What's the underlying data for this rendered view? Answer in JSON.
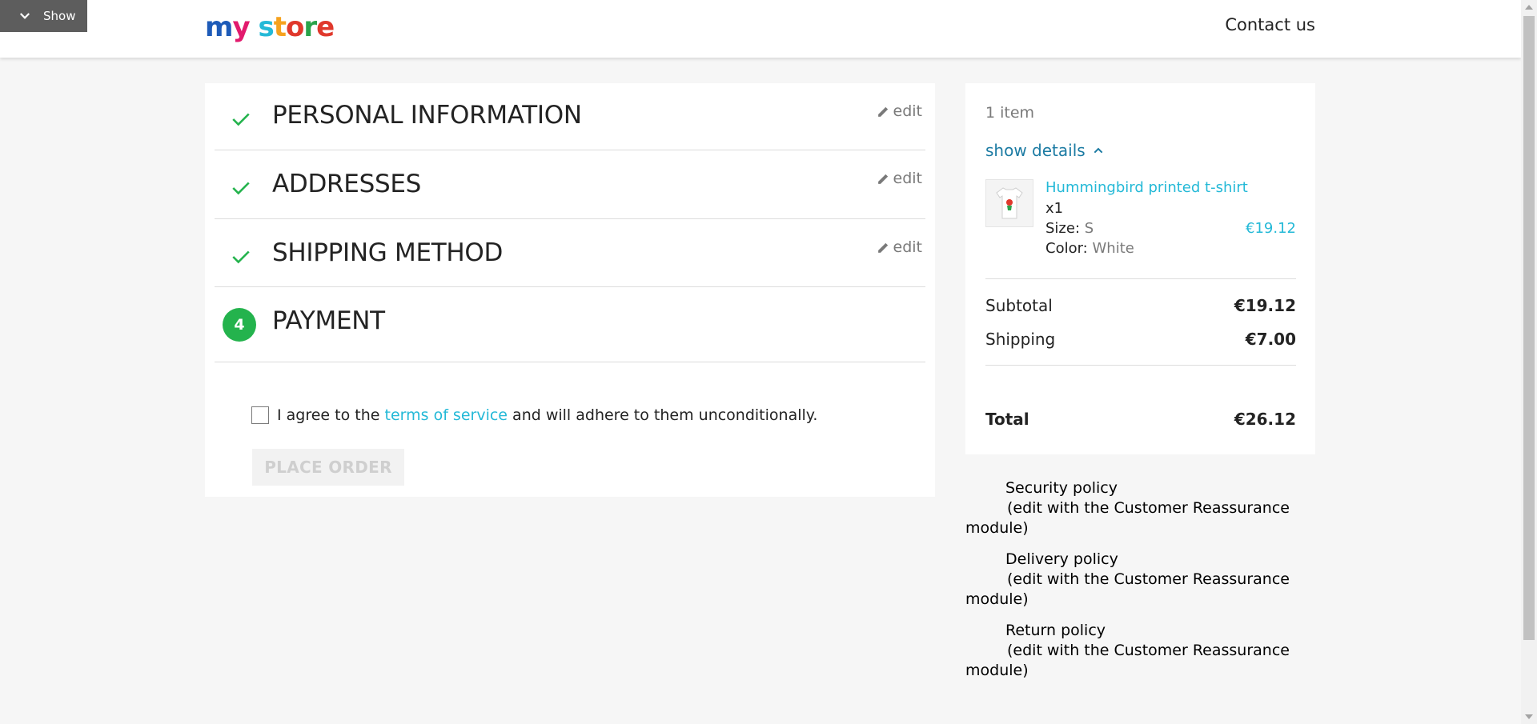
{
  "debug_toggle": {
    "label": "Show"
  },
  "header": {
    "logo_text": "my store",
    "contact_label": "Contact us"
  },
  "steps": [
    {
      "title": "PERSONAL INFORMATION",
      "status": "complete",
      "edit_label": "edit"
    },
    {
      "title": "ADDRESSES",
      "status": "complete",
      "edit_label": "edit"
    },
    {
      "title": "SHIPPING METHOD",
      "status": "complete",
      "edit_label": "edit"
    },
    {
      "title": "PAYMENT",
      "status": "current",
      "number": "4"
    }
  ],
  "terms": {
    "prefix": "I agree to the",
    "link": "terms of service",
    "suffix": "and will adhere to them unconditionally."
  },
  "place_order_label": "PLACE ORDER",
  "summary": {
    "items_count": "1 item",
    "show_details_label": "show details",
    "product": {
      "name": "Hummingbird printed t-shirt",
      "qty": "x1",
      "size_label": "Size:",
      "size_value": "S",
      "color_label": "Color:",
      "color_value": "White",
      "price": "€19.12"
    },
    "subtotal_label": "Subtotal",
    "subtotal_value": "€19.12",
    "shipping_label": "Shipping",
    "shipping_value": "€7.00",
    "total_label": "Total",
    "total_value": "€26.12"
  },
  "reassurance": [
    {
      "title": "Security policy",
      "desc": "(edit with the Customer Reassurance module)"
    },
    {
      "title": "Delivery policy",
      "desc": "(edit with the Customer Reassurance module)"
    },
    {
      "title": "Return policy",
      "desc": "(edit with the Customer Reassurance module)"
    }
  ],
  "colors": {
    "accent": "#24b9d7",
    "success": "#24b34d",
    "link_dark": "#1c7ba3"
  }
}
